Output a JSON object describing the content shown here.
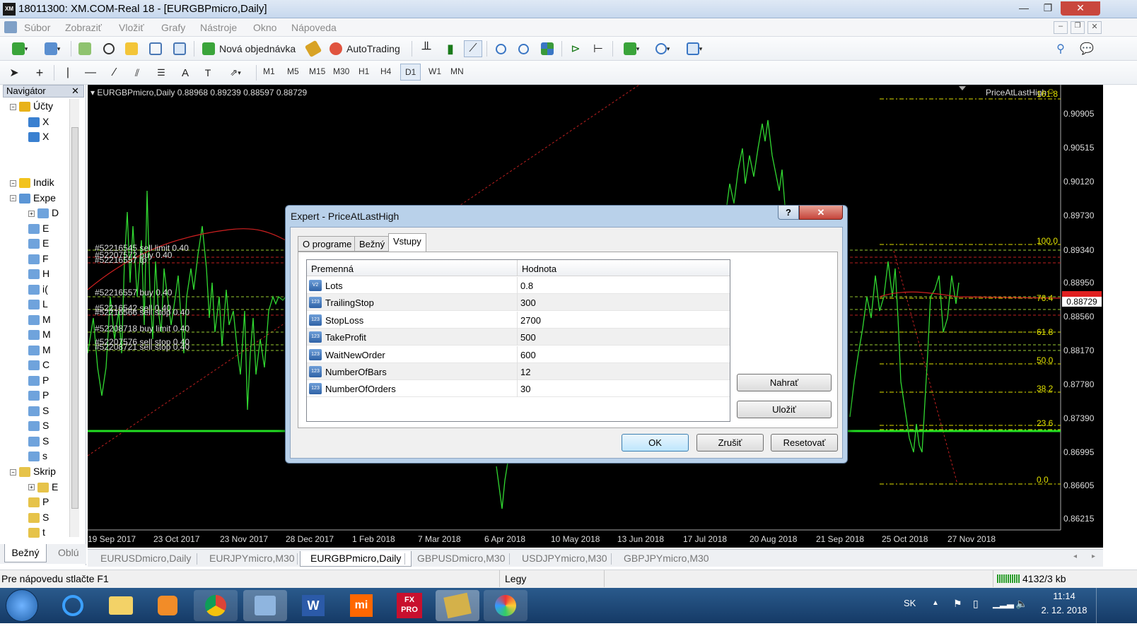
{
  "window": {
    "title": "18011300: XM.COM-Real 18 - [EURGBPmicro,Daily]",
    "app_icon": "XM",
    "minimize": "—",
    "restore": "❐",
    "close": "✕"
  },
  "menu": [
    "Súbor",
    "Zobraziť",
    "Vložiť",
    "Grafy",
    "Nástroje",
    "Okno",
    "Nápoveda"
  ],
  "toolbar": {
    "new_order": "Nová objednávka",
    "autotrading": "AutoTrading"
  },
  "timeframes": [
    "M1",
    "M5",
    "M15",
    "M30",
    "H1",
    "H4",
    "D1",
    "W1",
    "MN"
  ],
  "active_timeframe": "D1",
  "navigator": {
    "title": "Navigátor",
    "close": "✕",
    "items": [
      {
        "label": "Účty",
        "level": 0
      },
      {
        "label": "X",
        "level": 1
      },
      {
        "label": "X",
        "level": 1
      },
      {
        "label": "Indik",
        "level": 0
      },
      {
        "label": "Expe",
        "level": 0
      },
      {
        "label": "D",
        "level": 1
      },
      {
        "label": "E",
        "level": 1
      },
      {
        "label": "E",
        "level": 1
      },
      {
        "label": "F",
        "level": 1
      },
      {
        "label": "H",
        "level": 1
      },
      {
        "label": "i(",
        "level": 1
      },
      {
        "label": "L",
        "level": 1
      },
      {
        "label": "M",
        "level": 1
      },
      {
        "label": "M",
        "level": 1
      },
      {
        "label": "M",
        "level": 1
      },
      {
        "label": "C",
        "level": 1
      },
      {
        "label": "P",
        "level": 1
      },
      {
        "label": "P",
        "level": 1
      },
      {
        "label": "S",
        "level": 1
      },
      {
        "label": "S",
        "level": 1
      },
      {
        "label": "S",
        "level": 1
      },
      {
        "label": "s",
        "level": 1
      },
      {
        "label": "Skrip",
        "level": 0
      },
      {
        "label": "E",
        "level": 1
      },
      {
        "label": "P",
        "level": 1
      },
      {
        "label": "S",
        "level": 1
      },
      {
        "label": "t",
        "level": 1
      }
    ],
    "tabs": [
      "Bežný",
      "Oblú"
    ]
  },
  "chart": {
    "header": "EURGBPmicro,Daily  0.88968 0.89239 0.88597 0.88729",
    "ea_name": "PriceAtLastHigh",
    "ea_badge": "☺",
    "current_price": "0.88729",
    "colors": {
      "line": "#31d831",
      "ma": "#d02020",
      "fib": "#e0e000",
      "bg": "#000000"
    },
    "order_labels": [
      "#52216545 sell limit 0.40",
      "#52207572 buy 0.40",
      "#52216557 tp",
      "#52216557 buy 0.40",
      "#52216542 sell 0.40",
      "#52216566 sell stop 0.40",
      "#52208718 buy limit 0.40",
      "#52207576 sell stop 0.40",
      "#52208721 sell stop 0.40"
    ],
    "price_axis": [
      "0.90905",
      "0.90515",
      "0.90120",
      "0.89730",
      "0.89340",
      "0.88950",
      "0.88560",
      "0.88170",
      "0.87780",
      "0.87390",
      "0.86995",
      "0.86605",
      "0.86215"
    ],
    "time_axis": [
      "19 Sep 2017",
      "23 Oct 2017",
      "23 Nov 2017",
      "28 Dec 2017",
      "1 Feb 2018",
      "7 Mar 2018",
      "6 Apr 2018",
      "10 May 2018",
      "13 Jun 2018",
      "17 Jul 2018",
      "20 Aug 2018",
      "21 Sep 2018",
      "25 Oct 2018",
      "27 Nov 2018"
    ],
    "fib_levels": [
      "161.8",
      "100.0",
      "76.4",
      "61.8",
      "50.0",
      "38.2",
      "23.6",
      "0.0"
    ]
  },
  "chart_tabs": [
    "EURUSDmicro,Daily",
    "EURJPYmicro,M30",
    "EURGBPmicro,Daily",
    "GBPUSDmicro,M30",
    "USDJPYmicro,M30",
    "GBPJPYmicro,M30"
  ],
  "active_chart_tab": "EURGBPmicro,Daily",
  "status": {
    "help": "Pre nápovedu stlačte F1",
    "profile": "Legy",
    "traffic": "4132/3 kb"
  },
  "taskbar": {
    "lang": "SK",
    "time": "11:14",
    "date": "2. 12. 2018"
  },
  "dialog": {
    "title": "Expert - PriceAtLastHigh",
    "help": "?",
    "close": "✕",
    "tabs": [
      "O programe",
      "Bežný",
      "Vstupy"
    ],
    "active_tab": "Vstupy",
    "columns": [
      "Premenná",
      "Hodnota"
    ],
    "rows": [
      {
        "icon": "V2",
        "name": "Lots",
        "value": "0.8"
      },
      {
        "icon": "123",
        "name": "TrailingStop",
        "value": "300"
      },
      {
        "icon": "123",
        "name": "StopLoss",
        "value": "2700"
      },
      {
        "icon": "123",
        "name": "TakeProfit",
        "value": "500"
      },
      {
        "icon": "123",
        "name": "WaitNewOrder",
        "value": "600"
      },
      {
        "icon": "123",
        "name": "NumberOfBars",
        "value": "12"
      },
      {
        "icon": "123",
        "name": "NumberOfOrders",
        "value": "30"
      }
    ],
    "load": "Nahrať",
    "save": "Uložiť",
    "ok": "OK",
    "cancel": "Zrušiť",
    "reset": "Resetovať"
  }
}
